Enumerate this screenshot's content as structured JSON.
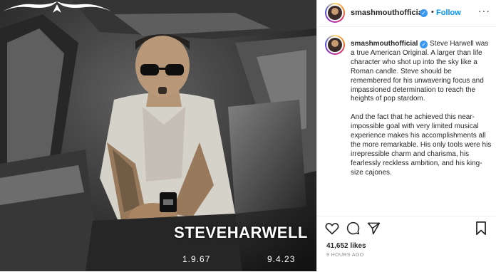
{
  "post": {
    "image": {
      "name_text": "STEVEHARWELL",
      "date_left": "1.9.67",
      "date_right": "9.4.23"
    },
    "header": {
      "username": "smashmouthofficial",
      "verified_glyph": "✓",
      "separator": "•",
      "follow_label": "Follow",
      "more_label": "···"
    },
    "caption": {
      "username": "smashmouthofficial",
      "paragraph1": "Steve Harwell was a true American Original. A larger than life character who shot up into the sky like a Roman candle. Steve should be remembered for his unwavering focus and impassioned determination to reach the heights of pop stardom.",
      "paragraph2": "And the fact that he achieved this near-impossible goal with very limited musical experience makes his accomplishments all the more remarkable. His only tools were his irrepressible charm and charisma, his fearlessly reckless ambition, and his king-size cajones."
    },
    "actions": {
      "icons": [
        "heart-icon",
        "comment-icon",
        "share-icon",
        "bookmark-icon"
      ]
    },
    "likes": "41,652 likes",
    "time_ago": "9 HOURS AGO"
  }
}
